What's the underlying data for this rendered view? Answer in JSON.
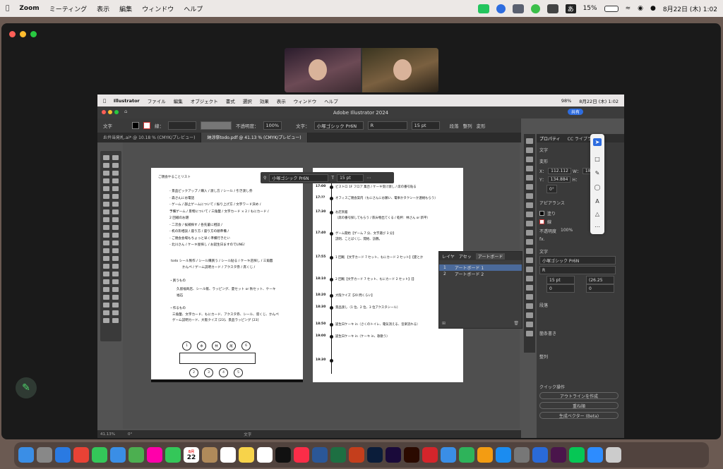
{
  "menubar": {
    "app": "Zoom",
    "items": [
      "ミーティング",
      "表示",
      "編集",
      "ウィンドウ",
      "ヘルプ"
    ],
    "battery": "15%",
    "clock": "8月22日 (木)  1:02",
    "ime": "あ"
  },
  "illustrator": {
    "app": "Illustrator",
    "menu": [
      "ファイル",
      "編集",
      "オブジェクト",
      "書式",
      "選択",
      "効果",
      "表示",
      "ウィンドウ",
      "ヘルプ"
    ],
    "battery": "98%",
    "clock": "8月22日 (木)  1:02",
    "title": "Adobe Illustrator 2024",
    "share": "共有",
    "control": {
      "label": "文字",
      "stroke_label": "線：",
      "opacity_label": "不透明度：",
      "opacity": "100%",
      "char_label": "文字：",
      "font": "小塚ゴシック Pr6N",
      "style": "R",
      "size": "15 pt",
      "paragraph": "段落",
      "align": "整列",
      "transform": "変形"
    },
    "tabs": [
      "お弁当発札.ai* @ 10.18 % (CMYK/プレビュー)",
      "納涼祭todo.pdf @ 41.13 % (CMYK/プレビュー)"
    ],
    "fontpop": {
      "font": "小塚ゴシック Pr6N",
      "size": "15 pt"
    },
    "artboard1": {
      "heading": "ご親会やることリスト",
      "bullets": [
        "- 景品ピックアップ / 購入 / 渡し方 / シール / 引き渡し券",
        "- 森さんにお電話",
        "- ゲーム / 部止ゲームについて / 振り上げ方 / 文字ワード決め /",
        "  予備ゲーム / 景物について / 三角籤 / 文字カード × 2 / もにカード /",
        "  2 回戦のお題",
        "- 二次会 / 候補探す / 各先輩に相談 /",
        "- 机の形相談 / 座り方 / 座り方の順準備 /",
        "- ご親会会場もちょっと早く準備行きたい",
        "- 北川さん / ケーキ屋探し / お誕生日ますのでLINE/"
      ],
      "todo": "todo   シール製作 / シール購買う / シール貼る / ケーキ店探し / 三角籤",
      "todo2": "かんぺ / ゲーム説明カード / アクスタ券 / 席くじ /",
      "buy_head": "・買うもの",
      "buy1": "久留福商店、シール帳、ラッピング、夏セット or 秋セット、ケーキ",
      "buy2": "福石",
      "make_head": "・作るもの",
      "make1": "三角籤、文字カード、もにカード、アクスタ券、シール、席くじ、かんぺ",
      "make2": "ゲーム説明カード、大阪クイズ [23]、景品ラッピング [23]",
      "circles_top": [
        "1",
        "本",
        "林",
        "尾",
        "6"
      ],
      "circles_bottom": [
        "2",
        "3",
        "4",
        "5"
      ]
    },
    "artboard2": {
      "timeline": [
        {
          "time": "17:00",
          "text": "ビストロ 1F フロア 集合 / ケーキ受け渡し / 席の番号貼る"
        },
        {
          "time": "17:??",
          "text": "オフィスご親会案内（もにさんにお願い、電車かタクシーか連絡もらう）"
        },
        {
          "time": "17:30",
          "text": "お店到着"
        },
        {
          "time": "",
          "text": "（席の番号探してもらう / 飲み物出てくる / 乾杯：林さん or 新平）"
        },
        {
          "time": "17:40",
          "text": "ゲーム開始【ゲーム 7 分、文字選び 3 分】"
        },
        {
          "time": "",
          "text": "説明、ことばくじ、開始、訪鶴。"
        },
        {
          "time": "17:55",
          "text": "1 回戦 【文字カード 7 セット、もにカード 2 セット】【夏とか"
        },
        {
          "time": "18:10",
          "text": "2 回戦【文字カード 7 セット、もにカード 2 セット】【】"
        },
        {
          "time": "18:20",
          "text": "大阪クイズ【20 問くらい】"
        },
        {
          "time": "18:30",
          "text": "景品渡し（1 位、2 位、3 位アクスタシール）"
        },
        {
          "time": "18:50",
          "text": "誕生日ケーキ in（さくのトイレ、電気消える、音楽流れる）"
        },
        {
          "time": "19:00",
          "text": "誕生日ケーキ in（ケーキ in、歌歌う）"
        },
        {
          "time": "19:30",
          "text": ""
        }
      ]
    },
    "layers_panel": {
      "tabs": [
        "レイヤ",
        "アセッ",
        "アートボード"
      ],
      "rows": [
        {
          "num": "1",
          "name": "アートボード 1"
        },
        {
          "num": "2",
          "name": "アートボード 2"
        }
      ]
    },
    "properties": {
      "tabs": [
        "プロパティ",
        "CC ライブラリ"
      ],
      "section_text": "文字",
      "transform": "変形",
      "x_label": "X：",
      "x": "112.112",
      "y_label": "Y：",
      "y": "134.884",
      "w_label": "W：",
      "w": "187",
      "h_label": "H：",
      "rotate": "0°",
      "appearance": "アピアランス",
      "fill": "塗り",
      "stroke": "線",
      "opacity_label": "不透明度",
      "opacity": "100%",
      "fx": "fx.",
      "char": "文字",
      "font": "小塚ゴシック Pr6N",
      "style": "R",
      "size": "15 pt",
      "leading": "(26.25",
      "tracking": "0",
      "kerning": "0",
      "paragraph": "段落",
      "bullets": "箇条書き",
      "align": "整列",
      "quick": "クイック操作",
      "btn_outline": "アウトラインを作成",
      "btn_arrange": "重ね順",
      "btn_vector": "生成ベクター (Beta)"
    },
    "status": {
      "zoom": "41.13%",
      "rotate": "0°",
      "tool": "文字"
    }
  },
  "dock": [
    "Finder",
    "Launchpad",
    "Safari",
    "Chrome",
    "Messages",
    "Mail",
    "Maps",
    "Photos",
    "FaceTime",
    "Calendar",
    "Contacts",
    "Reminders",
    "Notes",
    "Freeform",
    "TV",
    "Music",
    "Word",
    "Excel",
    "PowerPoint",
    "Ps",
    "Pr",
    "Ai",
    "Acrobat",
    "Keynote",
    "Numbers",
    "Pages",
    "App Store",
    "Settings",
    "Xcode",
    "Slack",
    "LINE",
    "Zoom",
    "Trash"
  ],
  "dock_calendar": {
    "month": "8月",
    "day": "22"
  },
  "colors": {
    "zoom_green": "#23c55e",
    "ai_bg": "#535353",
    "accent": "#2d6cdf"
  }
}
